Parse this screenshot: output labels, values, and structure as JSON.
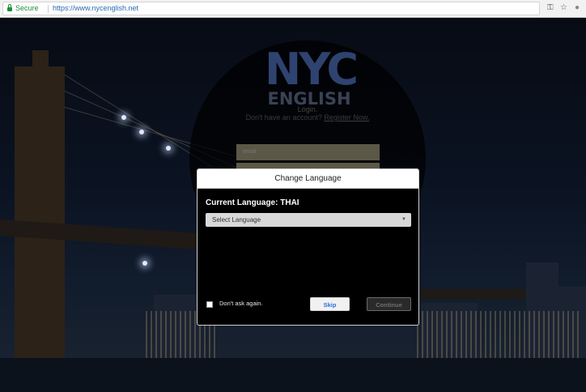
{
  "browser": {
    "secure_label": "Secure",
    "url": "https://www.nycenglish.net",
    "icons": [
      "lock-icon",
      "key-icon",
      "star-icon",
      "extension-icon"
    ]
  },
  "background": {
    "logo_main": "NYC",
    "logo_sub": "ENGLISH",
    "login_heading": "Login.",
    "register_prompt": "Don't have an account?",
    "register_link": "Register Now.",
    "email_placeholder": "email"
  },
  "modal": {
    "title": "Change Language",
    "current_language_label": "Current Language:",
    "current_language_value": "THAI",
    "select_placeholder": "Select Language",
    "dont_ask_label": "Don't ask again.",
    "dont_ask_checked": false,
    "skip_label": "Skip",
    "continue_label": "Continue",
    "continue_enabled": false
  },
  "colors": {
    "secure_green": "#1e8e3e",
    "url_blue": "#2b6cb0",
    "skip_text": "#2f6fd8"
  }
}
